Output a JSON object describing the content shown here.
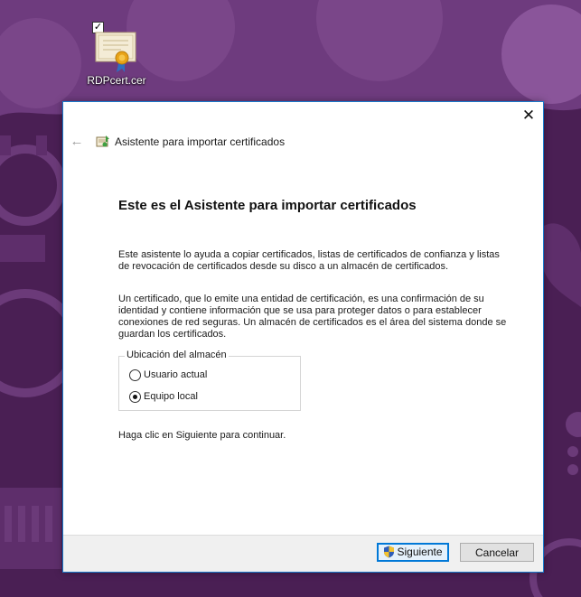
{
  "desktop": {
    "icon_label": "RDPcert.cer",
    "icon_checkbox": "✓",
    "icon_name": "certificate-file-icon"
  },
  "dialog": {
    "close_label": "✕",
    "back_label": "←",
    "wizard_title": "Asistente para importar certificados",
    "heading": "Este es el Asistente para importar certificados",
    "paragraph1": "Este asistente lo ayuda a copiar certificados, listas de certificados de confianza y listas de revocación de certificados desde su disco a un almacén de certificados.",
    "paragraph2": "Un certificado, que lo emite una entidad de certificación, es una confirmación de su identidad y contiene información que se usa para proteger datos o para establecer conexiones de red seguras. Un almacén de certificados es el área del sistema donde se guardan los certificados.",
    "store_location": {
      "legend": "Ubicación del almacén",
      "options": [
        {
          "label": "Usuario actual",
          "selected": false
        },
        {
          "label": "Equipo local",
          "selected": true
        }
      ]
    },
    "continue_text": "Haga clic en Siguiente para continuar.",
    "buttons": {
      "next": "Siguiente",
      "cancel": "Cancelar"
    }
  },
  "colors": {
    "wallpaper": "#4a1f54",
    "accent": "#0078d7",
    "footer": "#f0f0f0"
  }
}
